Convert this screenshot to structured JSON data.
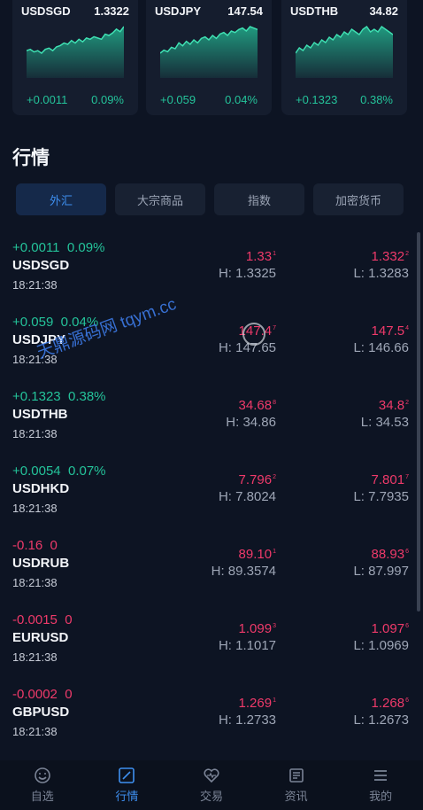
{
  "cards": [
    {
      "symbol": "USDSGD",
      "price": "1.3322",
      "change": "+0.0011",
      "percent": "0.09%",
      "spark": [
        22,
        21,
        23,
        22,
        24,
        21,
        20,
        22,
        19,
        18,
        16,
        17,
        14,
        16,
        13,
        15,
        12,
        13,
        11,
        12,
        13,
        9,
        10,
        8,
        5,
        7,
        3
      ]
    },
    {
      "symbol": "USDJPY",
      "price": "147.54",
      "change": "+0.059",
      "percent": "0.04%",
      "spark": [
        26,
        24,
        25,
        22,
        23,
        19,
        21,
        18,
        20,
        17,
        19,
        16,
        15,
        17,
        14,
        16,
        13,
        12,
        14,
        11,
        12,
        10,
        9,
        11,
        8,
        9,
        10
      ]
    },
    {
      "symbol": "USDTHB",
      "price": "34.82",
      "change": "+0.1323",
      "percent": "0.38%",
      "spark": [
        16,
        14,
        15,
        13,
        14,
        12,
        13,
        11,
        12,
        10,
        11,
        9,
        10,
        8,
        9,
        7,
        8,
        9,
        7,
        6,
        8,
        7,
        8,
        6,
        7,
        8,
        9
      ]
    }
  ],
  "section_title": "行情",
  "tabs": [
    "外汇",
    "大宗商品",
    "指数",
    "加密货币"
  ],
  "rows": [
    {
      "change": "+0.0011",
      "percent": "0.09%",
      "dir": "up",
      "symbol": "USDSGD",
      "time": "18:21:38",
      "bid": "1.33",
      "bid_sup": "1",
      "high": "H: 1.3325",
      "ask": "1.332",
      "ask_sup": "2",
      "low": "L: 1.3283"
    },
    {
      "change": "+0.059",
      "percent": "0.04%",
      "dir": "up",
      "symbol": "USDJPY",
      "time": "18:21:38",
      "bid": "147.4",
      "bid_sup": "7",
      "high": "H: 147.65",
      "ask": "147.5",
      "ask_sup": "4",
      "low": "L: 146.66"
    },
    {
      "change": "+0.1323",
      "percent": "0.38%",
      "dir": "up",
      "symbol": "USDTHB",
      "time": "18:21:38",
      "bid": "34.68",
      "bid_sup": "8",
      "high": "H: 34.86",
      "ask": "34.8",
      "ask_sup": "2",
      "low": "L: 34.53"
    },
    {
      "change": "+0.0054",
      "percent": "0.07%",
      "dir": "up",
      "symbol": "USDHKD",
      "time": "18:21:38",
      "bid": "7.796",
      "bid_sup": "2",
      "high": "H: 7.8024",
      "ask": "7.801",
      "ask_sup": "7",
      "low": "L: 7.7935"
    },
    {
      "change": "-0.16",
      "percent": "0",
      "dir": "down",
      "symbol": "USDRUB",
      "time": "18:21:38",
      "bid": "89.10",
      "bid_sup": "1",
      "high": "H: 89.3574",
      "ask": "88.93",
      "ask_sup": "6",
      "low": "L: 87.997"
    },
    {
      "change": "-0.0015",
      "percent": "0",
      "dir": "down",
      "symbol": "EURUSD",
      "time": "18:21:38",
      "bid": "1.099",
      "bid_sup": "3",
      "high": "H: 1.1017",
      "ask": "1.097",
      "ask_sup": "6",
      "low": "L: 1.0969"
    },
    {
      "change": "-0.0002",
      "percent": "0",
      "dir": "down",
      "symbol": "GBPUSD",
      "time": "18:21:38",
      "bid": "1.269",
      "bid_sup": "1",
      "high": "H: 1.2733",
      "ask": "1.268",
      "ask_sup": "6",
      "low": "L: 1.2673"
    }
  ],
  "watermark": "天鼎源码网 tqym.cc",
  "nav": [
    {
      "label": "自选",
      "icon": "smiley-icon"
    },
    {
      "label": "行情",
      "icon": "chart-square-icon"
    },
    {
      "label": "交易",
      "icon": "heart-pulse-icon"
    },
    {
      "label": "资讯",
      "icon": "newspaper-icon"
    },
    {
      "label": "我的",
      "icon": "menu-lines-icon"
    }
  ],
  "colors": {
    "up": "#24c39a",
    "down": "#ef3a6a",
    "accent": "#3e8ff0",
    "background": "#0d1423"
  }
}
